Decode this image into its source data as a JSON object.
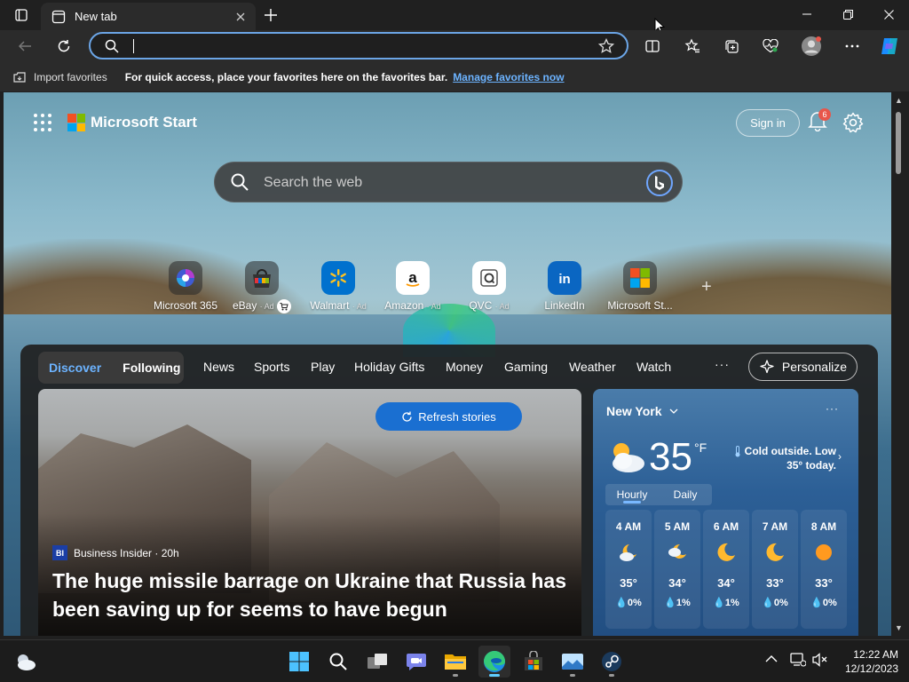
{
  "browser": {
    "tab_title": "New tab",
    "address_value": ""
  },
  "favorites_bar": {
    "import_label": "Import favorites",
    "hint": "For quick access, place your favorites here on the favorites bar.",
    "manage_link": "Manage favorites now"
  },
  "start": {
    "brand": "Microsoft Start",
    "sign_in": "Sign in",
    "notification_count": "6",
    "search_placeholder": "Search the web"
  },
  "quick_links": [
    {
      "label": "Microsoft 365",
      "ad": "",
      "icon": "microsoft-365-icon"
    },
    {
      "label": "eBay",
      "ad": "· Ad",
      "icon": "ebay-icon"
    },
    {
      "label": "Walmart",
      "ad": "· Ad",
      "icon": "walmart-icon"
    },
    {
      "label": "Amazon",
      "ad": "· Ad",
      "icon": "amazon-icon"
    },
    {
      "label": "QVC",
      "ad": "· Ad",
      "icon": "qvc-icon"
    },
    {
      "label": "LinkedIn",
      "ad": "",
      "icon": "linkedin-icon"
    },
    {
      "label": "Microsoft St...",
      "ad": "",
      "icon": "microsoft-store-icon"
    }
  ],
  "feed": {
    "segments": [
      "Discover",
      "Following"
    ],
    "nav": [
      "News",
      "Sports",
      "Play",
      "Holiday Gifts",
      "Money",
      "Gaming",
      "Weather",
      "Watch"
    ],
    "more": "···",
    "personalize": "Personalize",
    "refresh": "Refresh stories",
    "story": {
      "source_badge": "BI",
      "source": "Business Insider · 20h",
      "headline": "The huge missile barrage on Ukraine that Russia has been saving up for seems to have begun"
    }
  },
  "weather": {
    "city": "New York",
    "more": "···",
    "temp": "35",
    "unit": "°F",
    "summary": "Cold outside. Low 35° today.",
    "tabs": [
      "Hourly",
      "Daily"
    ],
    "hours": [
      {
        "time": "4 AM",
        "temp": "35°",
        "precip": "0%",
        "icon": "partly-cloudy-night-icon"
      },
      {
        "time": "5 AM",
        "temp": "34°",
        "precip": "1%",
        "icon": "partly-cloudy-night-icon"
      },
      {
        "time": "6 AM",
        "temp": "34°",
        "precip": "1%",
        "icon": "moon-icon"
      },
      {
        "time": "7 AM",
        "temp": "33°",
        "precip": "0%",
        "icon": "moon-icon"
      },
      {
        "time": "8 AM",
        "temp": "33°",
        "precip": "0%",
        "icon": "sun-icon"
      }
    ]
  },
  "taskbar": {
    "time": "12:22 AM",
    "date": "12/12/2023"
  },
  "colors": {
    "accent": "#6cb3ff",
    "refresh_button": "#1a6fd1",
    "notification_badge": "#e8564a"
  }
}
